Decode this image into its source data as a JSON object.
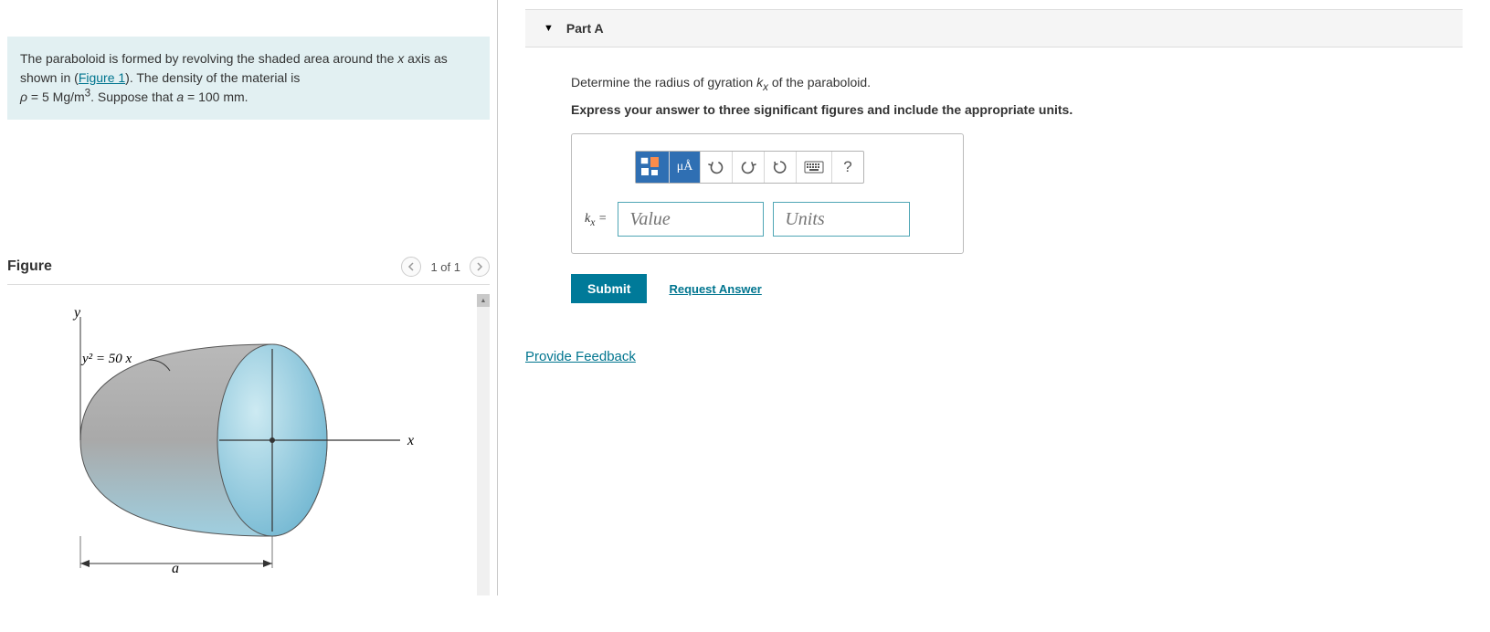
{
  "problem": {
    "text_before_link": "The paraboloid is formed by revolving the shaded area around the x axis as shown in (",
    "figure_link": "Figure 1",
    "text_after_link": "). The density of the material is ρ = 5 Mg/m³. Suppose that a = 100 mm.",
    "rho_value": "5",
    "rho_units": "Mg/m³",
    "a_value": "100",
    "a_units": "mm"
  },
  "figure": {
    "title": "Figure",
    "counter": "1 of 1",
    "equation": "y² = 50 x",
    "y_label": "y",
    "x_label": "x",
    "a_label": "a"
  },
  "partA": {
    "header": "Part A",
    "prompt": "Determine the radius of gyration kₓ of the paraboloid.",
    "instruction": "Express your answer to three significant figures and include the appropriate units.",
    "kx_label": "kₓ =",
    "value_placeholder": "Value",
    "units_placeholder": "Units",
    "submit": "Submit",
    "request_answer": "Request Answer",
    "toolbar": {
      "templates_icon": "templates-icon",
      "units_icon": "μÅ",
      "undo_icon": "undo-icon",
      "redo_icon": "redo-icon",
      "reset_icon": "reset-icon",
      "keyboard_icon": "keyboard-icon",
      "help_icon": "?"
    }
  },
  "feedback": {
    "link": "Provide Feedback"
  },
  "chart_data": {
    "type": "diagram",
    "description": "Paraboloid of revolution about x-axis",
    "curve": "y^2 = 50 x",
    "x_range": [
      0,
      "a"
    ],
    "a_mm": 100,
    "density_Mg_per_m3": 5
  }
}
